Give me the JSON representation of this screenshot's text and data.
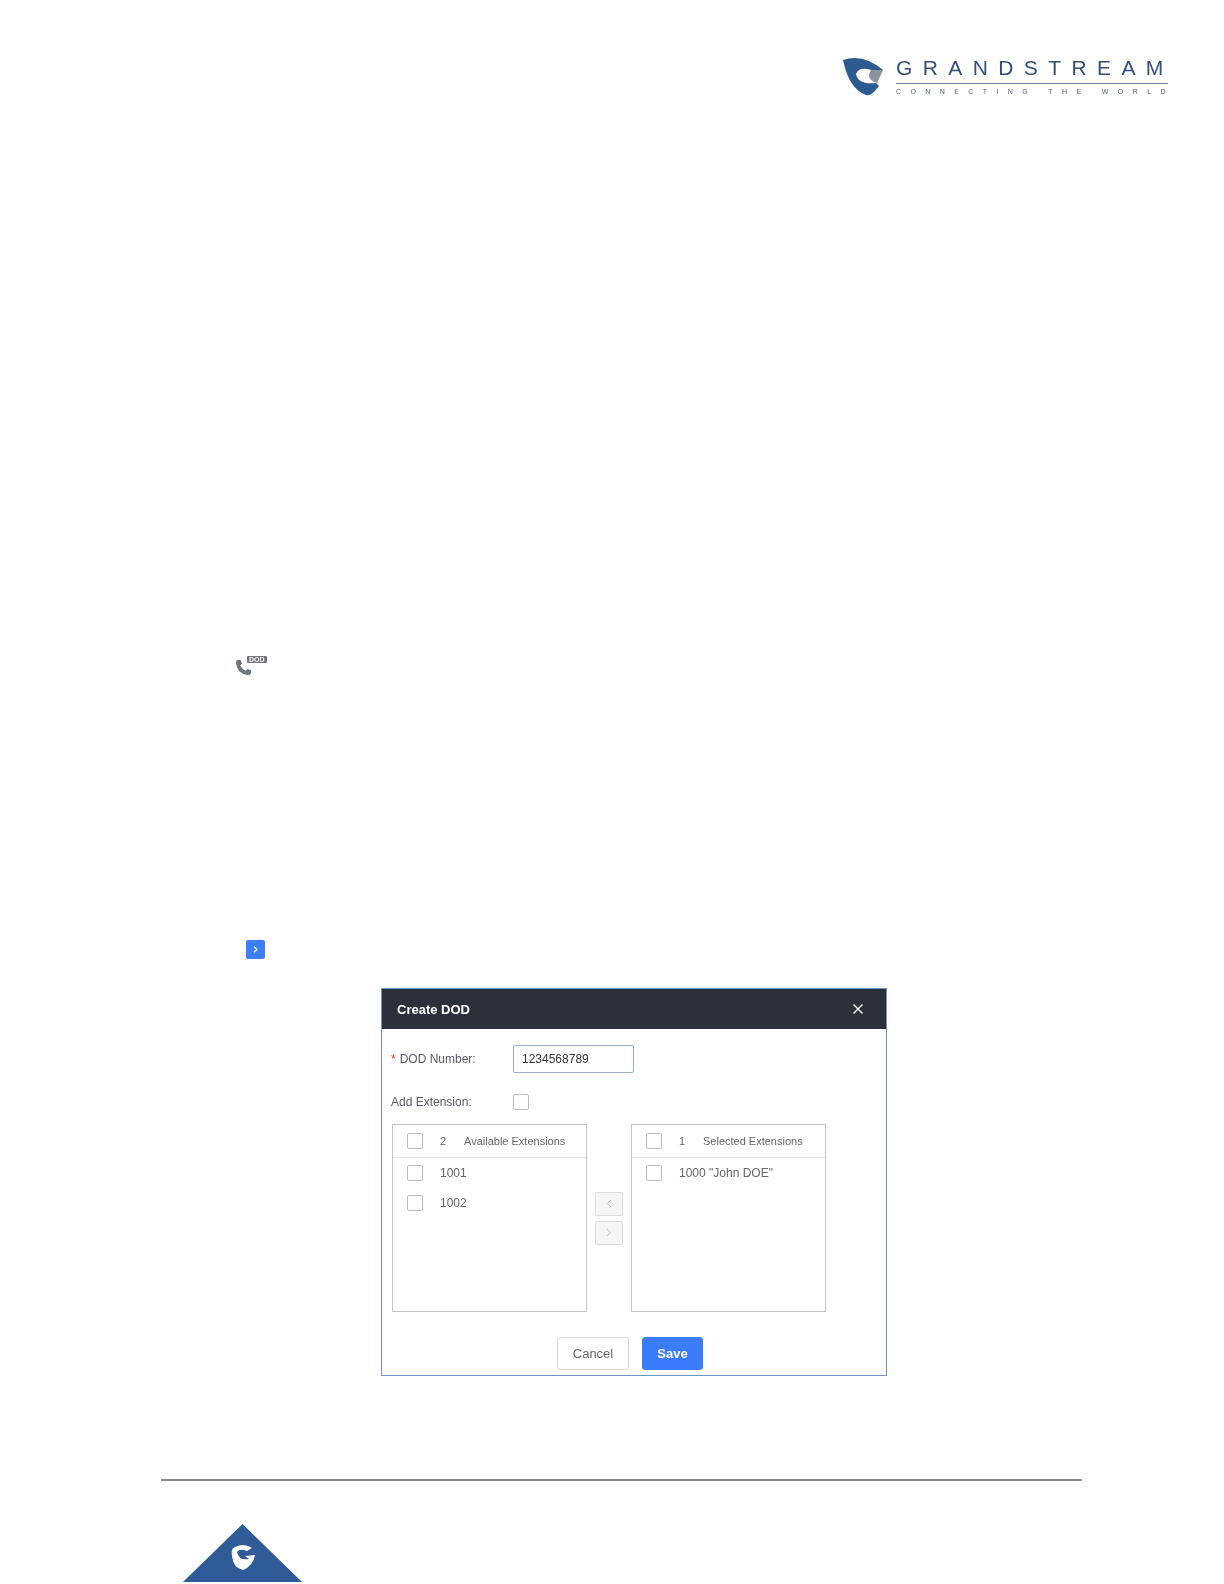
{
  "header": {
    "logo": {
      "name": "GRANDSTREAM",
      "tagline": "CONNECTING THE WORLD"
    }
  },
  "dod_icon": {
    "badge": "DOD"
  },
  "dialog": {
    "title": "Create DOD",
    "fields": [
      {
        "kind": "text",
        "required_mark": "*",
        "label": "DOD Number:",
        "value": "1234568789"
      },
      {
        "kind": "checkbox",
        "label": "Add Extension:",
        "checked": false
      }
    ],
    "available": {
      "checked": false,
      "count": "2",
      "title": "Available Extensions",
      "items": [
        {
          "label": "1001",
          "checked": false
        },
        {
          "label": "1002",
          "checked": false
        }
      ]
    },
    "transfer_buttons": [
      {
        "kind": "left",
        "disabled": true
      },
      {
        "kind": "right",
        "disabled": true
      }
    ],
    "selected": {
      "checked": false,
      "count": "1",
      "title": "Selected Extensions",
      "items": [
        {
          "label": "1000 \"John DOE\"",
          "checked": false
        }
      ]
    },
    "buttons": [
      {
        "kind": "secondary",
        "label": "Cancel"
      },
      {
        "kind": "primary",
        "label": "Save"
      }
    ]
  }
}
